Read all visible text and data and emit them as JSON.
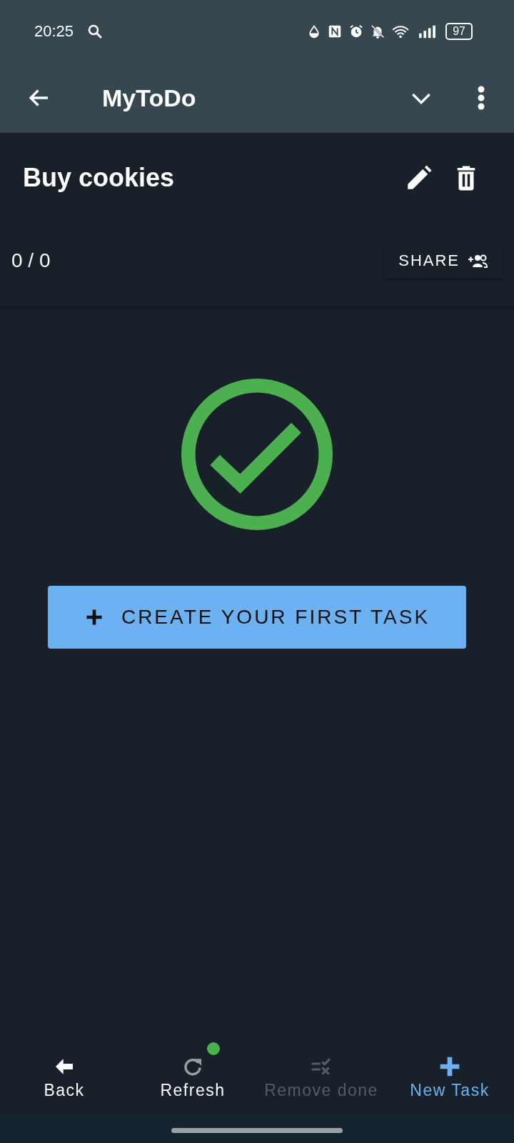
{
  "status_bar": {
    "time": "20:25",
    "battery": "97"
  },
  "app_bar": {
    "title": "MyToDo"
  },
  "list": {
    "title": "Buy cookies",
    "progress": "0 / 0",
    "share_label": "SHARE"
  },
  "empty_state": {
    "button": "CREATE YOUR FIRST TASK"
  },
  "bottom_nav": [
    {
      "kind": "back",
      "label": "Back",
      "disabled": false,
      "accent": false,
      "badge": false
    },
    {
      "kind": "refresh",
      "label": "Refresh",
      "disabled": false,
      "accent": false,
      "badge": true
    },
    {
      "kind": "remove",
      "label": "Remove done",
      "disabled": true,
      "accent": false,
      "badge": false
    },
    {
      "kind": "new",
      "label": "New Task",
      "disabled": false,
      "accent": true,
      "badge": false
    }
  ]
}
